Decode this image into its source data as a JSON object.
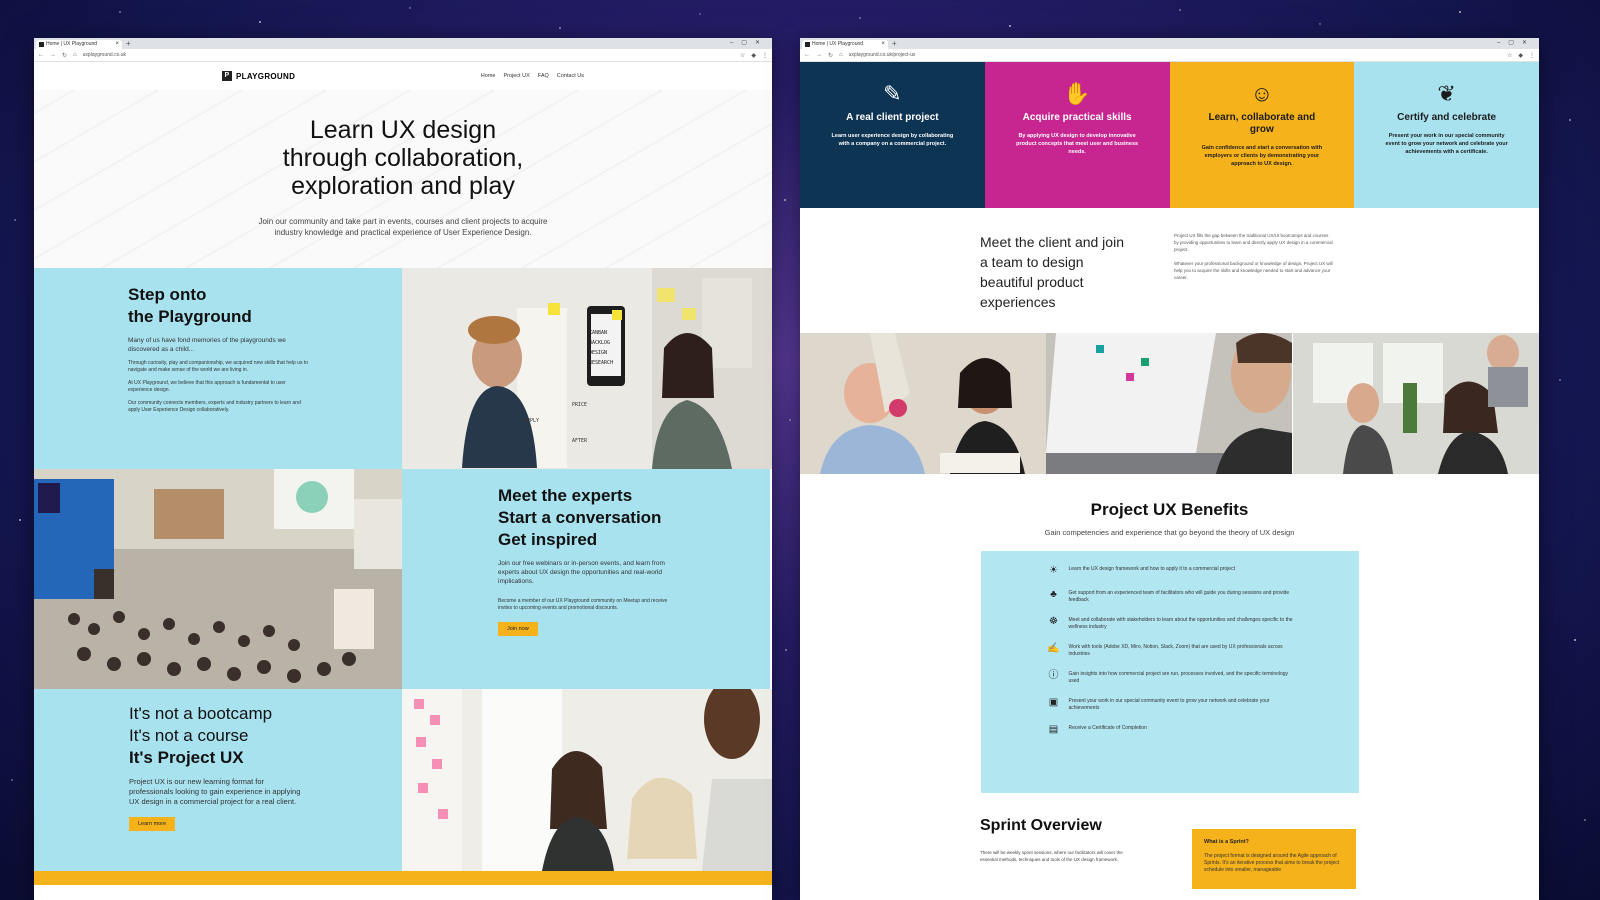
{
  "left_window": {
    "tab_title": "Home | UX Playground",
    "url": "uxplayground.co.uk",
    "site": {
      "logo": "PLAYGROUND",
      "nav": [
        "Home",
        "Project UX",
        "FAQ",
        "Contact Us"
      ]
    },
    "hero": {
      "title_line1": "Learn UX design",
      "title_line2": "through collaboration,",
      "title_line3": "exploration and play",
      "subtitle": "Join our community and take part in events, courses and client projects to acquire industry knowledge and practical experience of User Experience Design."
    },
    "step": {
      "title_line1": "Step onto",
      "title_line2": "the Playground",
      "lead": "Many of us have fond memories of the playgrounds we discovered as a child...",
      "p1": "Through curiosity, play and companionship, we acquired new skills that help us to navigate and make sense of the world we are living in.",
      "p2": "At UX Playground, we believe that this approach is fundamental to user experience design.",
      "p3": "Our community connects members, experts and industry partners to learn and apply User Experience Design collaboratively."
    },
    "experts": {
      "title_line1": "Meet the experts",
      "title_line2": "Start a conversation",
      "title_line3": "Get inspired",
      "lead": "Join our free webinars or in-person events, and learn from experts about UX design the opportunities and real-world implications.",
      "p1": "Become a member of our UX Playground community on Meetup and receive invites to upcoming events and promotional discounts.",
      "button": "Join now"
    },
    "projectux": {
      "line1": "It's not a bootcamp",
      "line2": "It's not a course",
      "line3": "It's Project UX",
      "body": "Project UX is our new learning format for professionals looking to gain experience in applying UX design in a commercial project for a real client.",
      "button": "Learn more"
    },
    "wall_notes": [
      "KANBAN",
      "BACKLOG",
      "DESIGN",
      "RESEARCH",
      "APPLY",
      "PRICE",
      "AFTER"
    ]
  },
  "right_window": {
    "tab_title": "Home | UX Playground",
    "url": "uxplayground.co.uk/project-ux",
    "cards": [
      {
        "icon": "client-icon",
        "title": "A real client project",
        "desc": "Learn user experience design by collaborating with a company on a commercial project.",
        "color": "#0e3454"
      },
      {
        "icon": "skills-icon",
        "title": "Acquire practical skills",
        "desc": "By applying UX design to develop innovative product concepts that meet user and business needs.",
        "color": "#c7258f"
      },
      {
        "icon": "team-icon",
        "title": "Learn, collaborate and grow",
        "desc": "Gain confidence and start a conversation with employers or clients by demonstrating your approach to UX design.",
        "color": "#f6b21a"
      },
      {
        "icon": "laurel-icon",
        "title": "Certify and celebrate",
        "desc": "Present your work in our special community event to grow your network and celebrate your achievements with a certificate.",
        "color": "#a8e2ef"
      }
    ],
    "meet": {
      "big": "Meet the client and join a team to design beautiful product experiences",
      "p1": "Project UX fills the gap between the traditional UX/UI bootcamps and courses by providing opportunities to learn and directly apply UX design in a commercial project.",
      "p2": "Whatever your professional background or knowledge of design, Project UX will help you to acquire the skills and knowledge needed to start and advance your career."
    },
    "benefits": {
      "title": "Project UX Benefits",
      "subtitle": "Gain competencies and experience that go beyond the theory of UX design",
      "items": [
        {
          "icon": "lightbulb-icon",
          "text": "Learn the UX design framework and how to apply it to a commercial project"
        },
        {
          "icon": "support-icon",
          "text": "Get support from an experienced team of facilitators who will guide you during sessions and provide feedback"
        },
        {
          "icon": "stakeholders-icon",
          "text": "Meet and collaborate with stakeholders to learn about the opportunities and challenges specific to the wellness industry"
        },
        {
          "icon": "tools-icon",
          "text": "Work with tools (Adobe XD, Miro, Notion, Slack, Zoom) that are used by UX professionals across industries"
        },
        {
          "icon": "info-icon",
          "text": "Gain insights into how commercial project are run, processes involved, and the specific terminology used"
        },
        {
          "icon": "presentation-icon",
          "text": "Present your work in our special community event to grow your network and celebrate your achievements"
        },
        {
          "icon": "certificate-icon",
          "text": "Receive a Certificate of Completion"
        }
      ]
    },
    "sprint": {
      "title": "Sprint Overview",
      "text": "There will be weekly sprint sessions, where our facilitators will cover the essential methods, techniques and tools of the UX design framework.",
      "box_title": "What is a Sprint?",
      "box_text": "The project format is designed around the Agile approach of Sprints. It's an iterative process that aims to break the project schedule into smaller, manageable"
    }
  }
}
